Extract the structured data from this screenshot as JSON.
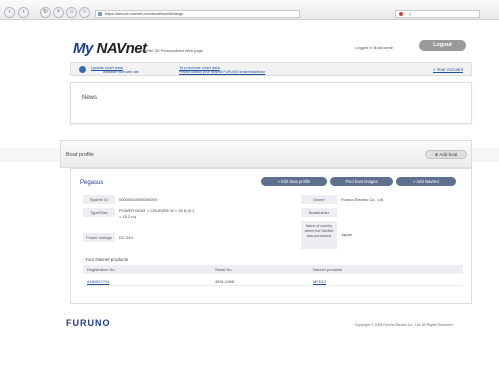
{
  "browser": {
    "back_glyph": "‹",
    "forward_glyph": "›",
    "reload_glyph": "↻",
    "stop_glyph": "×",
    "home_glyph": "⌂",
    "bookmark_glyph": "☆",
    "url": "https://secure.navnet.com/boat/boatSettings",
    "search_text": "g"
  },
  "header": {
    "logo_my": "My ",
    "logo_navnet": "NAVnet",
    "logo_sub": "NavNet 3D Personalized Web page",
    "user_info": "Logged in Boat name",
    "logout_label": "Logout"
  },
  "notice": {
    "link1": "Update chart data",
    "link1_sub": "available from web site",
    "link2": "To purchase chart data",
    "link2_sub": "Please contact your nearest FURUNO dealer/distributor",
    "your_account": "» Your Account"
  },
  "news": {
    "title": "News"
  },
  "boat_profile": {
    "title": "Boat profile",
    "add_boat_label": "⊕ Add boat",
    "boat_name": "Pegasus",
    "buttons": {
      "edit_boat_profile": "» Edit boat profile",
      "find_boat_images": "Find boat images",
      "add_boat_to": "» Add NavNet"
    },
    "fields": {
      "system_id_label": "System ID",
      "system_id_value": "00000000000000000",
      "type_label": "Type/Size",
      "type_value_1": "POWER BOAT > CRUISER/ M > 30 ft (9.1",
      "type_value_2": "> 15.2 m)",
      "power_label": "Power Voltage",
      "power_value": "DC 24V",
      "owner_label": "Owner",
      "owner_value": "Furuno Electric Co., Ltd.",
      "boatbuilder_label": "Boatbuilder",
      "boatbuilder_value": "",
      "area_label_1": "Name of country",
      "area_label_2": "where the NavNet",
      "area_label_3": "was purchased",
      "area_value": "Japan"
    },
    "registered": {
      "title": "Your Navnet products",
      "headers": [
        "Registration No.",
        "Serial No.",
        "Navnet products"
      ],
      "rows": [
        {
          "reg": "0480007704",
          "serial": "4591-0495",
          "product": "MFD12"
        }
      ]
    }
  },
  "footer": {
    "brand": "FURUNO",
    "copyright": "Copyright © 2008 Furuno Electric Co., Ltd. All Rights Reserved"
  },
  "colors": {
    "brand_blue": "#1e3f8f",
    "link_blue": "#1f4f9f",
    "pill_slate": "#5e6f8f",
    "logout_gray": "#9a9a9a"
  }
}
